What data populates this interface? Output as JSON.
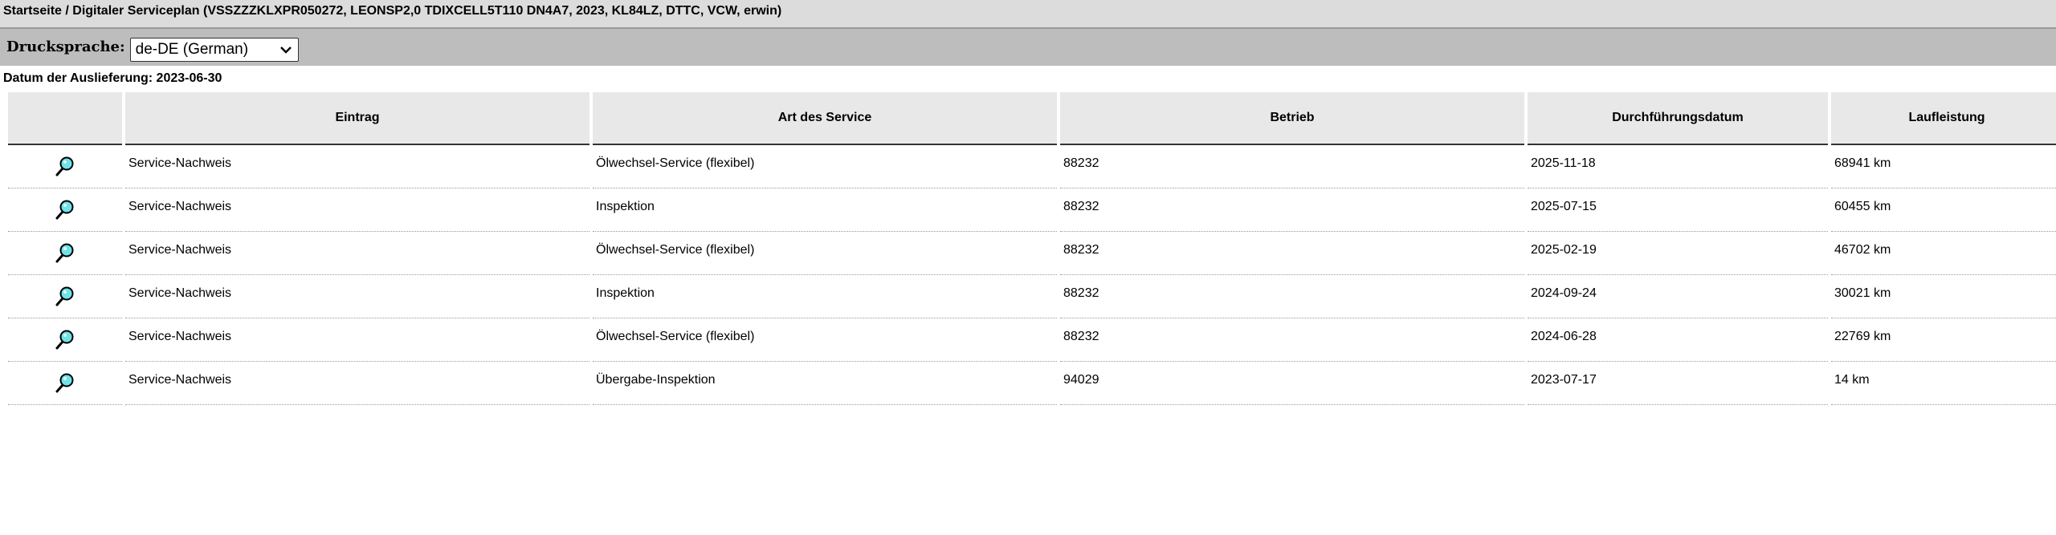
{
  "breadcrumb": "Startseite / Digitaler Serviceplan (VSSZZZKLXPR050272, LEONSP2,0 TDIXCELL5T110 DN4A7, 2023, KL84LZ, DTTC, VCW, erwin)",
  "print_language": {
    "label": "Drucksprache:",
    "selected": "de-DE (German)"
  },
  "delivery_date": "Datum der Auslieferung: 2023-06-30",
  "table": {
    "headers": [
      "",
      "Eintrag",
      "Art des Service",
      "Betrieb",
      "Durchführungsdatum",
      "Laufleistung"
    ],
    "rows": [
      {
        "icon": "magnifier-icon",
        "eintrag": "Service-Nachweis",
        "art": "Ölwechsel-Service (flexibel)",
        "betrieb": "88232",
        "datum": "2025-11-18",
        "laufleistung": "68941 km"
      },
      {
        "icon": "magnifier-icon",
        "eintrag": "Service-Nachweis",
        "art": "Inspektion",
        "betrieb": "88232",
        "datum": "2025-07-15",
        "laufleistung": "60455 km"
      },
      {
        "icon": "magnifier-icon",
        "eintrag": "Service-Nachweis",
        "art": "Ölwechsel-Service (flexibel)",
        "betrieb": "88232",
        "datum": "2025-02-19",
        "laufleistung": "46702 km"
      },
      {
        "icon": "magnifier-icon",
        "eintrag": "Service-Nachweis",
        "art": "Inspektion",
        "betrieb": "88232",
        "datum": "2024-09-24",
        "laufleistung": "30021 km"
      },
      {
        "icon": "magnifier-icon",
        "eintrag": "Service-Nachweis",
        "art": "Ölwechsel-Service (flexibel)",
        "betrieb": "88232",
        "datum": "2024-06-28",
        "laufleistung": "22769 km"
      },
      {
        "icon": "magnifier-icon",
        "eintrag": "Service-Nachweis",
        "art": "Übergabe-Inspektion",
        "betrieb": "94029",
        "datum": "2023-07-17",
        "laufleistung": "14 km"
      }
    ]
  },
  "colors": {
    "breadcrumb_bg": "#dcdcdc",
    "lang_bar_bg": "#bdbdbd",
    "header_bg": "#e8e8e8",
    "magnifier_lens": "#6fe3e8"
  }
}
